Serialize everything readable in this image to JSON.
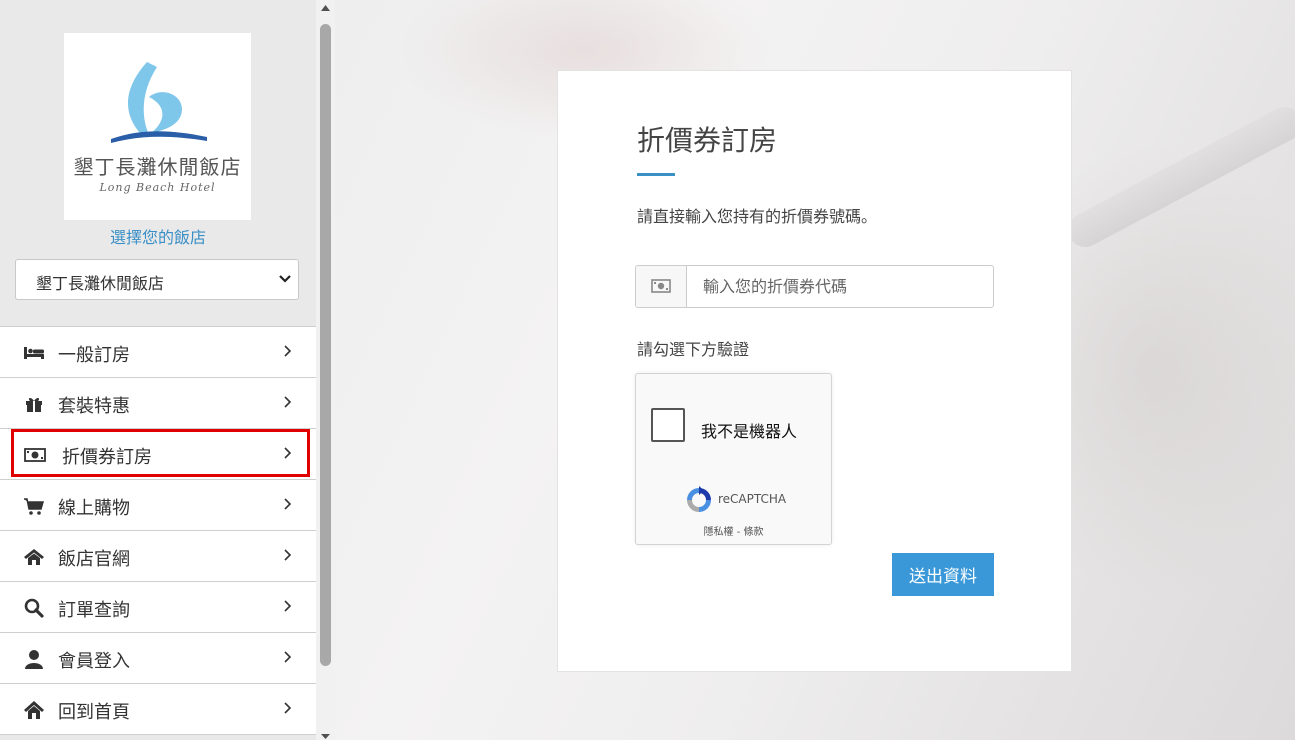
{
  "sidebar": {
    "logo": {
      "name": "墾丁長灘休閒飯店",
      "english": "Long Beach Hotel",
      "colors": {
        "wave": "#7ec6ea",
        "accent": "#2b5ea8"
      }
    },
    "choose_hotel_label": "選擇您的飯店",
    "hotel_select": {
      "value": "墾丁長灘休閒飯店"
    },
    "menu": [
      {
        "label": "一般訂房",
        "icon": "bed-icon"
      },
      {
        "label": "套裝特惠",
        "icon": "gift-icon"
      },
      {
        "label": "折價券訂房",
        "icon": "money-bill-icon",
        "highlighted": true
      },
      {
        "label": "線上購物",
        "icon": "shopping-cart-icon"
      },
      {
        "label": "飯店官網",
        "icon": "home-icon"
      },
      {
        "label": "訂單查詢",
        "icon": "search-icon"
      },
      {
        "label": "會員登入",
        "icon": "user-icon"
      },
      {
        "label": "回到首頁",
        "icon": "home-icon"
      }
    ],
    "highlight_color": "#e00000"
  },
  "main": {
    "title": "折價券訂房",
    "description": "請直接輸入您持有的折價券號碼。",
    "coupon_input": {
      "placeholder": "輸入您的折價券代碼",
      "value": ""
    },
    "verify_label": "請勾選下方驗證",
    "captcha": {
      "checkbox_label": "我不是機器人",
      "brand": "reCAPTCHA",
      "privacy": "隱私權",
      "separator": " - ",
      "terms": "條款"
    },
    "submit_label": "送出資料",
    "accent_color": "#3a98d8"
  }
}
